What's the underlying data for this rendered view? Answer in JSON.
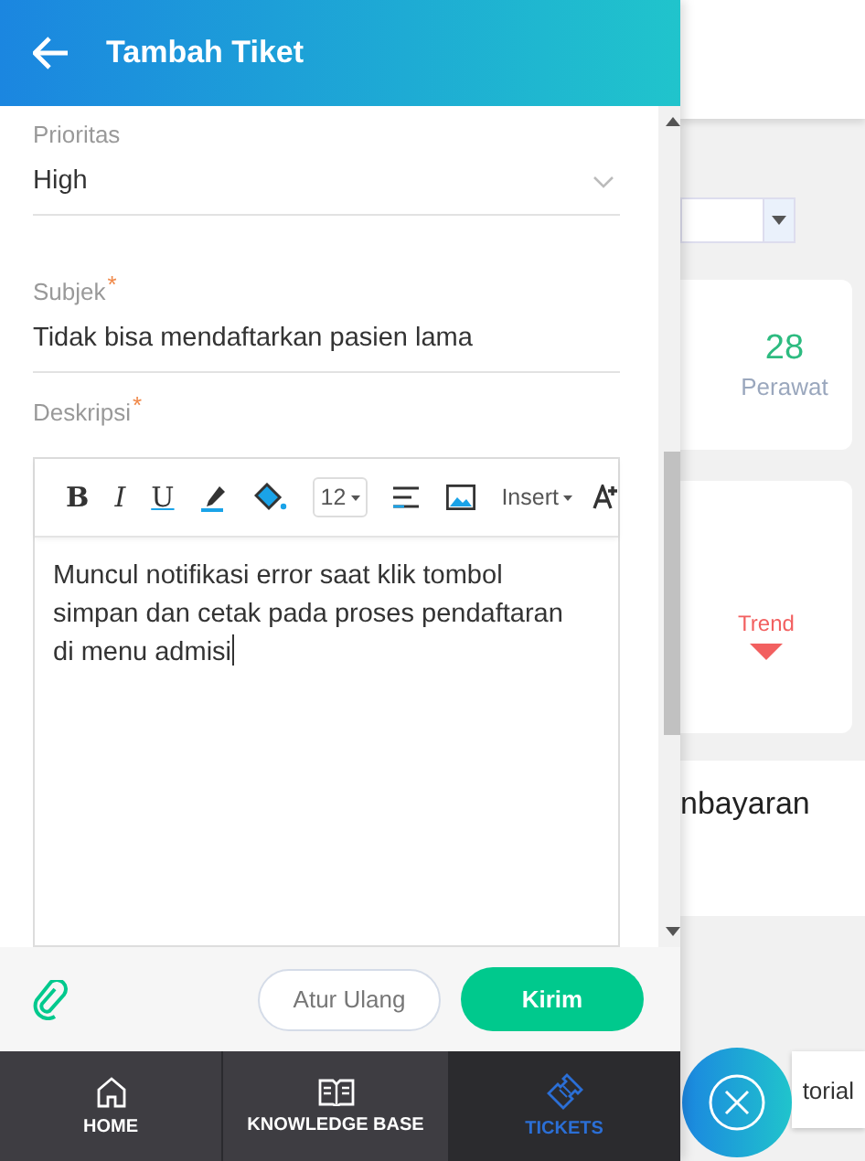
{
  "header": {
    "title": "Tambah Tiket"
  },
  "form": {
    "fields": [
      {
        "label": "Prioritas",
        "value": "High",
        "kind": "select"
      },
      {
        "label": "Subjek",
        "required_mark": "*",
        "value": "Tidak bisa mendaftarkan pasien lama",
        "kind": "text"
      }
    ],
    "description": {
      "label": "Deskripsi",
      "required_mark": "*",
      "toolbar": [
        {
          "kind": "bold",
          "label": "B"
        },
        {
          "kind": "italic",
          "label": "I"
        },
        {
          "kind": "underline",
          "label": "U"
        }
      ],
      "font_size": "12",
      "insert_label": "Insert",
      "text": "Muncul notifikasi error saat klik tombol simpan dan cetak pada proses pendaftaran di menu admisi"
    }
  },
  "actions": {
    "reset": "Atur Ulang",
    "submit": "Kirim"
  },
  "nav": [
    {
      "label": "HOME",
      "kind": "home",
      "selected": false
    },
    {
      "label": "KNOWLEDGE BASE",
      "kind": "book",
      "selected": false
    },
    {
      "label": "TICKETS",
      "kind": "ticket",
      "selected": true
    }
  ],
  "background": {
    "stat_value": "28",
    "stat_label": "Perawat",
    "trend_label": "Trend",
    "heading_fragment": "nbayaran",
    "tab_fragment": "torial"
  }
}
